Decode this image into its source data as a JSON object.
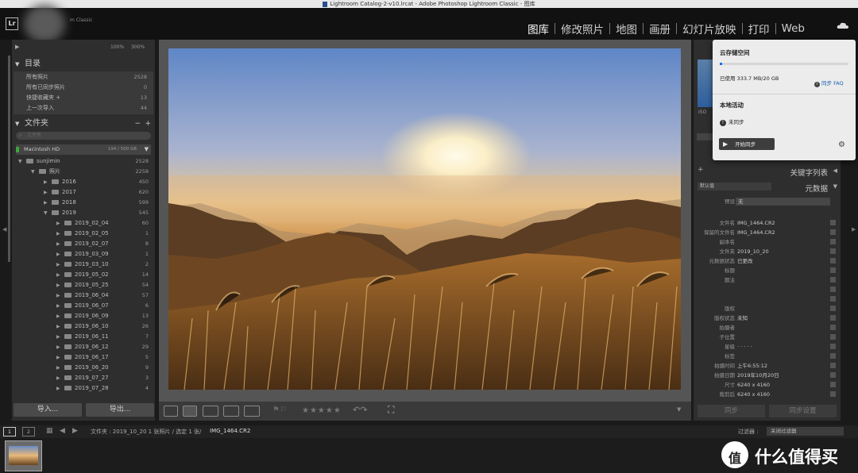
{
  "window": {
    "title": "Lightroom Catalog-2-v10.lrcat - Adobe Photoshop Lightroom Classic - 图库"
  },
  "app": {
    "logo": "Lr",
    "subtitle": "m Classic"
  },
  "modules": [
    "图库",
    "修改照片",
    "地图",
    "画册",
    "幻灯片放映",
    "打印",
    "Web"
  ],
  "navigator": {
    "zoom1": "100%",
    "zoom2": "300%"
  },
  "catalog": {
    "title": "目录",
    "items": [
      {
        "label": "所有照片",
        "count": "2528"
      },
      {
        "label": "所有已同步照片",
        "count": "0"
      },
      {
        "label": "快捷收藏夹 +",
        "count": "13"
      },
      {
        "label": "上一次导入",
        "count": "44"
      }
    ]
  },
  "folders": {
    "title": "文件夹",
    "plus": "+",
    "minus": "−",
    "search_placeholder": "文件夹",
    "volume": {
      "name": "Macintosh HD",
      "size": "194 / 500 GB"
    },
    "root": {
      "name": "sunjimin",
      "count": "2528"
    },
    "photos": {
      "name": "照片",
      "count": "2258"
    },
    "years": [
      {
        "name": "2016",
        "count": "450"
      },
      {
        "name": "2017",
        "count": "620"
      },
      {
        "name": "2018",
        "count": "599"
      },
      {
        "name": "2019",
        "count": "545"
      }
    ],
    "subfolders": [
      {
        "name": "2019_02_04",
        "count": "60"
      },
      {
        "name": "2019_02_05",
        "count": "1"
      },
      {
        "name": "2019_02_07",
        "count": "8"
      },
      {
        "name": "2019_03_09",
        "count": "1"
      },
      {
        "name": "2019_03_10",
        "count": "2"
      },
      {
        "name": "2019_05_02",
        "count": "14"
      },
      {
        "name": "2019_05_25",
        "count": "54"
      },
      {
        "name": "2019_06_04",
        "count": "57"
      },
      {
        "name": "2019_06_07",
        "count": "6"
      },
      {
        "name": "2019_06_09",
        "count": "13"
      },
      {
        "name": "2019_06_10",
        "count": "26"
      },
      {
        "name": "2019_06_11",
        "count": "7"
      },
      {
        "name": "2019_06_12",
        "count": "29"
      },
      {
        "name": "2019_06_17",
        "count": "5"
      },
      {
        "name": "2019_06_20",
        "count": "9"
      },
      {
        "name": "2019_07_27",
        "count": "3"
      },
      {
        "name": "2019_07_28",
        "count": "4"
      }
    ]
  },
  "buttons": {
    "import": "导入...",
    "export": "导出..."
  },
  "cloud": {
    "storage_title": "云存储空间",
    "used": "已使用 333.7 MB/20 GB",
    "used_fraction": 0.016,
    "faq": "同步 FAQ",
    "local_title": "本地活动",
    "status": "未同步",
    "start_sync": "开始同步"
  },
  "right": {
    "histogram_label": "ISO",
    "keywords_title": "关键字列表",
    "metadata_title": "元数据",
    "preset_dropdown": "默认值",
    "preset_label": "预设",
    "preset_value": "无",
    "fields": [
      {
        "label": "文件名",
        "value": "IMG_1464.CR2"
      },
      {
        "label": "保留的文件名",
        "value": "IMG_1464.CR2"
      },
      {
        "label": "副本名",
        "value": ""
      },
      {
        "label": "文件夹",
        "value": "2019_10_20"
      },
      {
        "label": "元数据状态",
        "value": "已更改"
      },
      {
        "label": "标题",
        "value": ""
      },
      {
        "label": "题注",
        "value": ""
      },
      {
        "label": "",
        "value": ""
      },
      {
        "label": "",
        "value": ""
      },
      {
        "label": "版权",
        "value": ""
      },
      {
        "label": "版权状态",
        "value": "未知"
      },
      {
        "label": "拍摄者",
        "value": ""
      },
      {
        "label": "子位置",
        "value": ""
      },
      {
        "label": "星级",
        "value": "·  ·  ·  ·  ·"
      },
      {
        "label": "标签",
        "value": ""
      },
      {
        "label": "拍摄时间",
        "value": "上午6:55:12"
      },
      {
        "label": "拍摄日期",
        "value": "2019年10月20日"
      },
      {
        "label": "尺寸",
        "value": "6240 x 4160"
      },
      {
        "label": "裁剪后",
        "value": "6240 x 4160"
      }
    ],
    "sync_button": "同步",
    "sync_settings_button": "同步设置"
  },
  "filmbar": {
    "page1": "1",
    "page2": "2",
    "info": "文件夹 : 2019_10_20    1 张照片 / 选定 1 张/",
    "filename": "IMG_1464.CR2",
    "filter_label": "过滤器 :",
    "filter_value": "关闭过滤器"
  },
  "watermark": {
    "text": "什么值得买"
  },
  "colors": {
    "accent": "#1473e6",
    "panel": "#2e2e2e",
    "background": "#1a1a1a"
  }
}
